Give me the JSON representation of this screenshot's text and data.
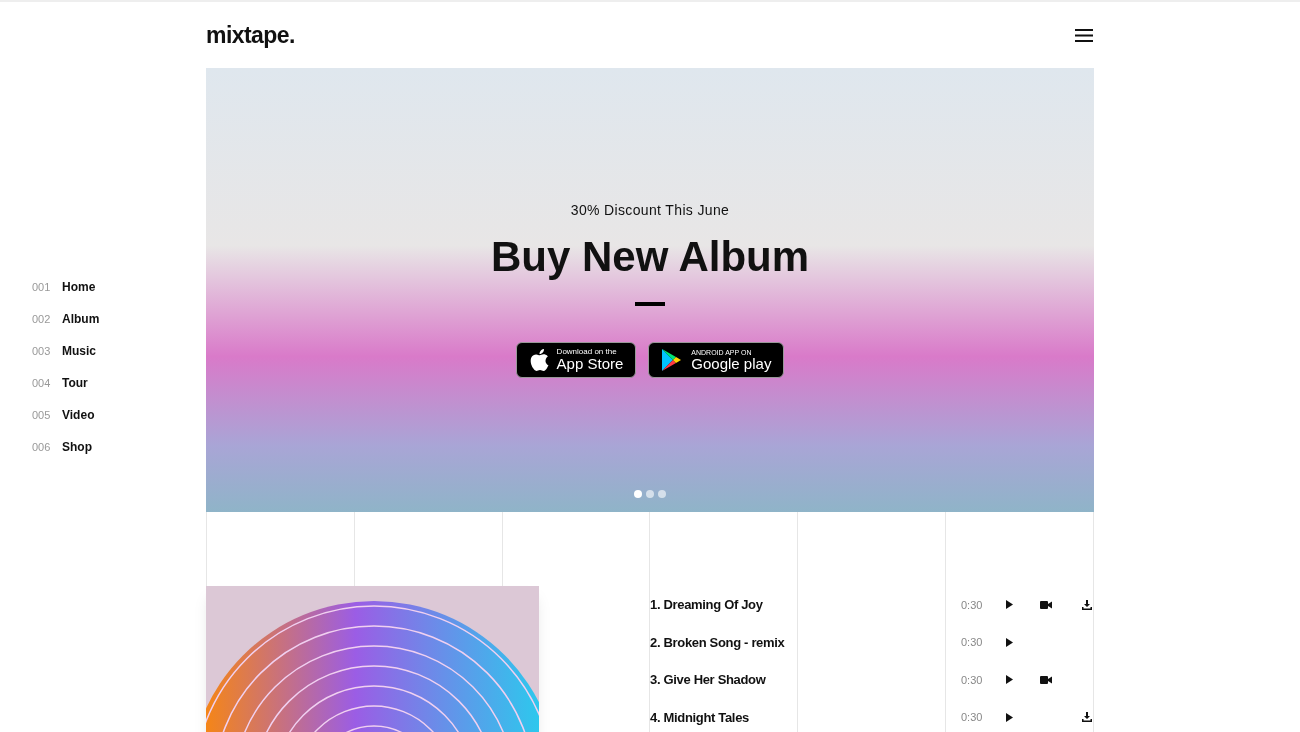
{
  "header": {
    "logo": "mixtape."
  },
  "nav": [
    {
      "number": "001",
      "label": "Home"
    },
    {
      "number": "002",
      "label": "Album"
    },
    {
      "number": "003",
      "label": "Music"
    },
    {
      "number": "004",
      "label": "Tour"
    },
    {
      "number": "005",
      "label": "Video"
    },
    {
      "number": "006",
      "label": "Shop"
    }
  ],
  "hero": {
    "kicker": "30% Discount This June",
    "title": "Buy New Album",
    "stores": [
      {
        "kind": "apple",
        "small": "Download on the",
        "big": "App Store"
      },
      {
        "kind": "google",
        "small": "ANDROID APP ON",
        "big": "Google play"
      }
    ],
    "dots": [
      {
        "selected": true
      },
      {
        "selected": false
      },
      {
        "selected": false
      }
    ]
  },
  "tracks": [
    {
      "title": "1. Dreaming Of Joy",
      "duration": "0:30",
      "video": true,
      "download": true
    },
    {
      "title": "2. Broken Song - remix",
      "duration": "0:30",
      "video": false,
      "download": false
    },
    {
      "title": "3. Give Her Shadow",
      "duration": "0:30",
      "video": true,
      "download": false
    },
    {
      "title": "4. Midnight Tales",
      "duration": "0:30",
      "video": false,
      "download": true
    }
  ]
}
